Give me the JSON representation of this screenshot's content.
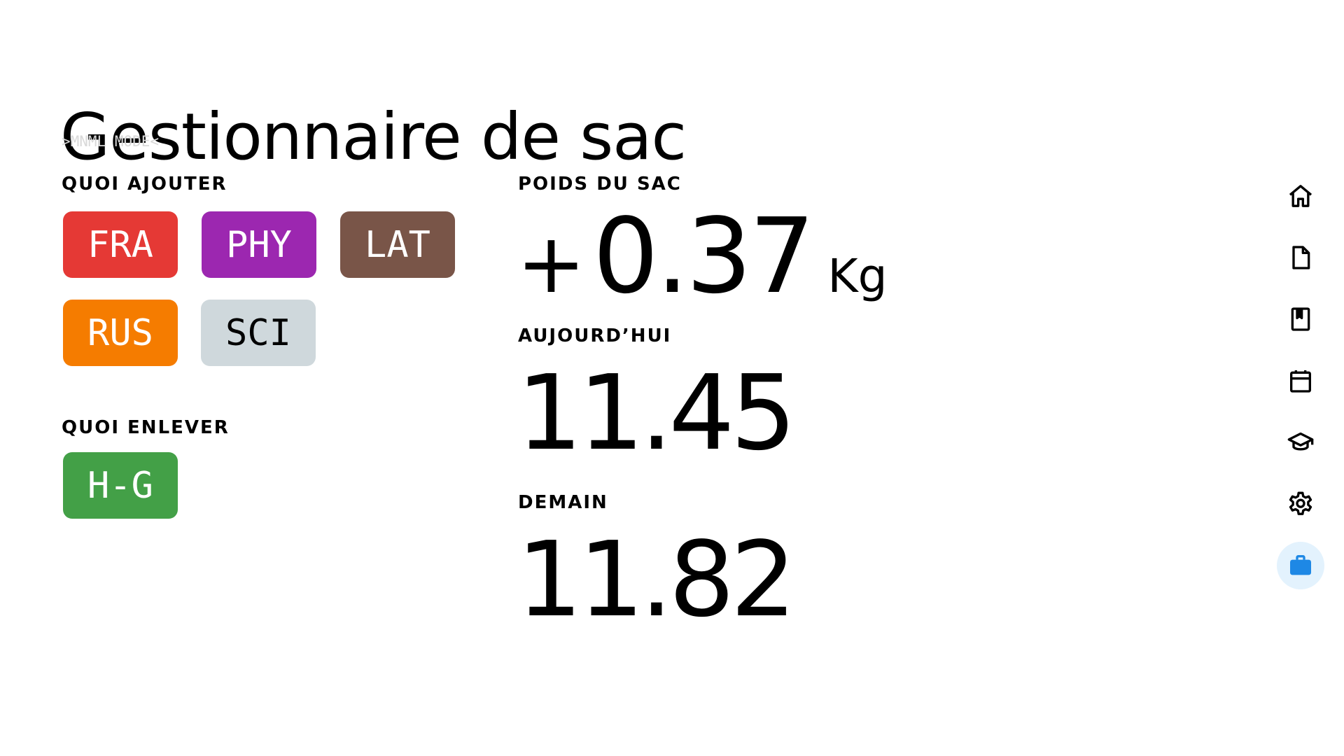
{
  "header": {
    "title": "Gestionnaire de sac",
    "mode_tag": ">MNML MODE<"
  },
  "add_section": {
    "label": "QUOI AJOUTER",
    "subjects": [
      {
        "label": "FRA",
        "color": "#e53935"
      },
      {
        "label": "PHY",
        "color": "#9c27b0"
      },
      {
        "label": "LAT",
        "color": "#795548"
      },
      {
        "label": "RUS",
        "color": "#f57c00"
      },
      {
        "label": "SCI",
        "color": "#cfd8dc"
      }
    ]
  },
  "remove_section": {
    "label": "QUOI ENLEVER",
    "subjects": [
      {
        "label": "H-G",
        "color": "#43a047"
      }
    ]
  },
  "bag_weight": {
    "label": "POIDS DU SAC",
    "sign": "+",
    "value": "0.37",
    "unit": "Kg"
  },
  "today": {
    "label": "AUJOURD’HUI",
    "value": "11.45"
  },
  "tomorrow": {
    "label": "DEMAIN",
    "value": "11.82"
  },
  "nav": {
    "items": [
      {
        "icon": "home-icon"
      },
      {
        "icon": "document-icon"
      },
      {
        "icon": "bookmark-book-icon"
      },
      {
        "icon": "calendar-icon"
      },
      {
        "icon": "graduation-cap-icon"
      },
      {
        "icon": "gear-icon"
      },
      {
        "icon": "briefcase-icon",
        "active": true
      }
    ],
    "active_color": "#1e88e5",
    "active_background": "#e3f2fd"
  }
}
